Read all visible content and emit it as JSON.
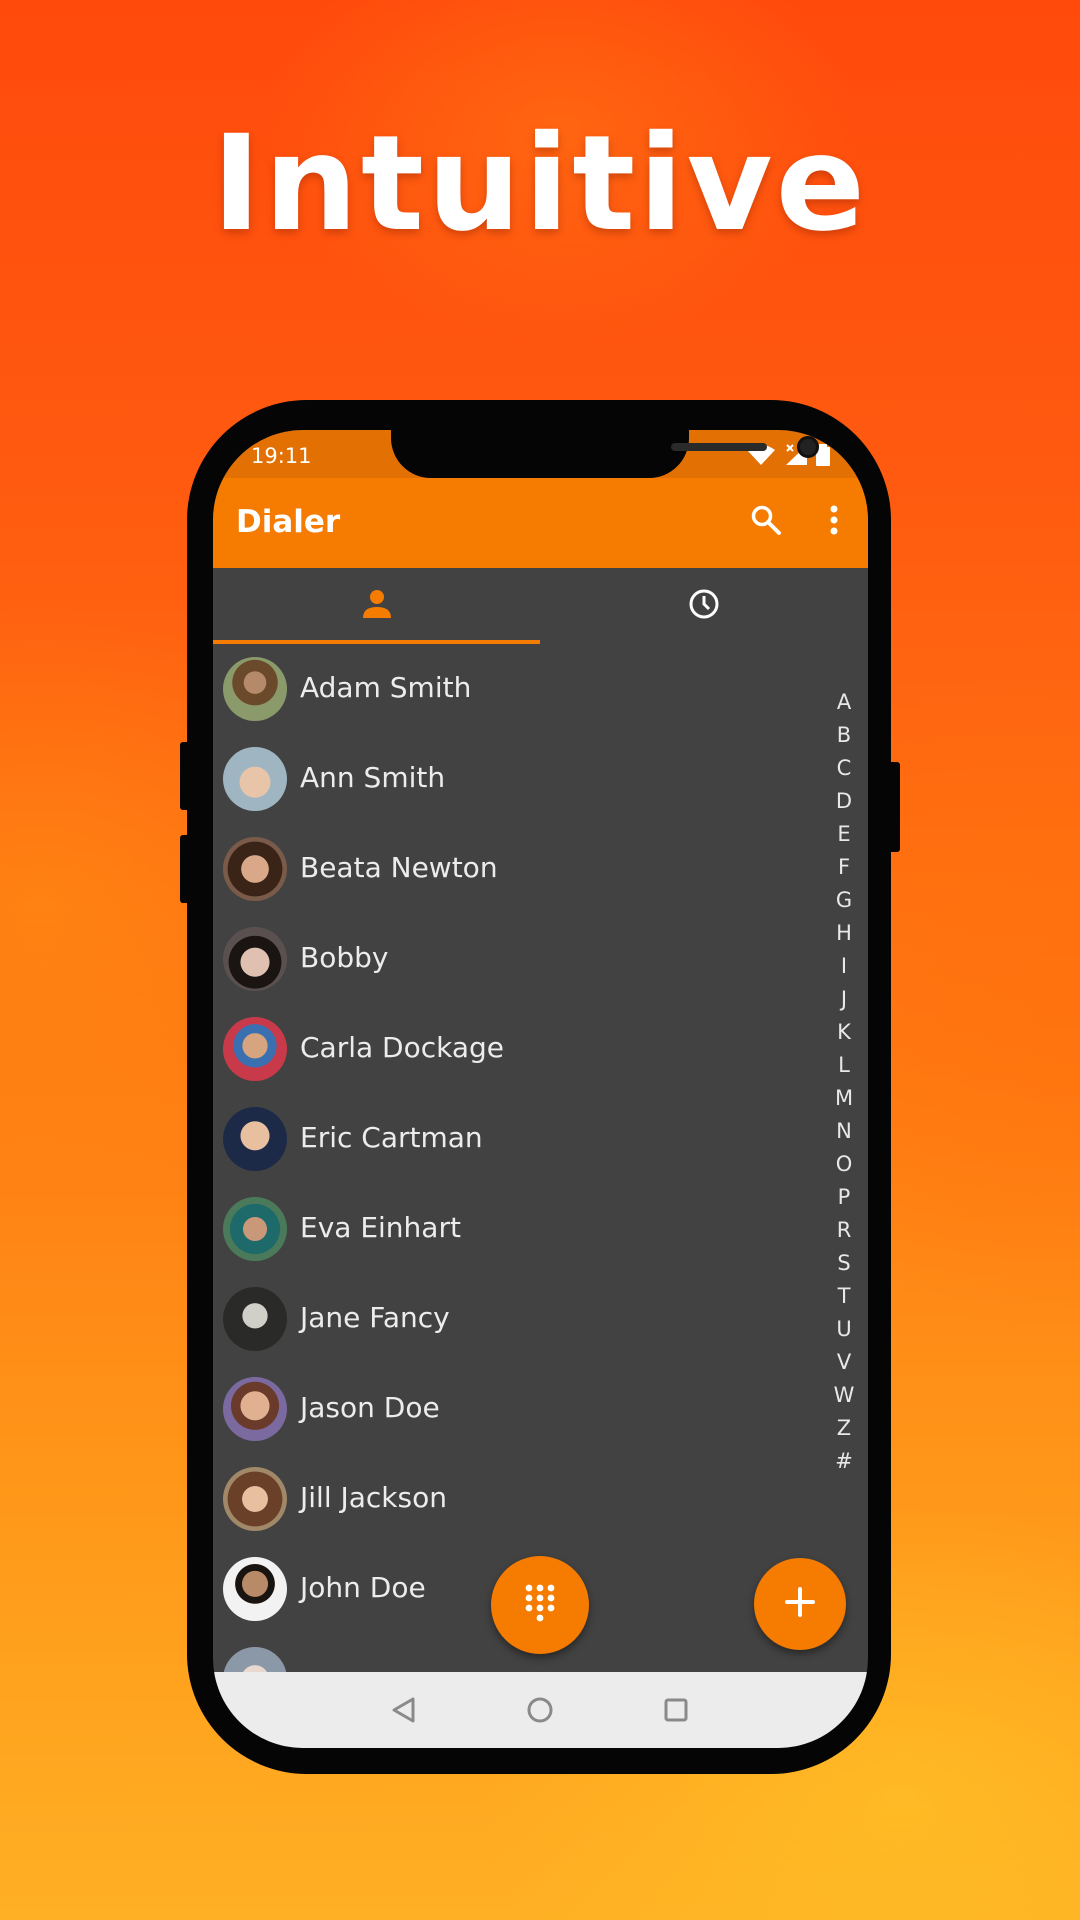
{
  "headline": "Intuitive",
  "status_bar": {
    "time": "19:11",
    "icons": [
      "wifi-icon",
      "signal-icon",
      "battery-icon"
    ]
  },
  "app_bar": {
    "title": "Dialer",
    "icons": [
      "search-icon",
      "more-vert-icon"
    ]
  },
  "tabs": [
    {
      "icon": "person-icon",
      "selected": true
    },
    {
      "icon": "clock-icon",
      "selected": false
    }
  ],
  "contacts": [
    {
      "name": "Adam Smith"
    },
    {
      "name": "Ann Smith"
    },
    {
      "name": "Beata Newton"
    },
    {
      "name": "Bobby"
    },
    {
      "name": "Carla Dockage"
    },
    {
      "name": "Eric Cartman"
    },
    {
      "name": "Eva Einhart"
    },
    {
      "name": "Jane Fancy"
    },
    {
      "name": "Jason Doe"
    },
    {
      "name": "Jill Jackson"
    },
    {
      "name": "John Doe"
    }
  ],
  "alphabet": [
    "A",
    "B",
    "C",
    "D",
    "E",
    "F",
    "G",
    "H",
    "I",
    "J",
    "K",
    "L",
    "M",
    "N",
    "O",
    "P",
    "R",
    "S",
    "T",
    "U",
    "V",
    "W",
    "Z",
    "#"
  ],
  "fabs": {
    "dialpad": "dialpad-icon",
    "add": "plus-icon"
  },
  "nav_bar": [
    "back-icon",
    "home-icon",
    "recents-icon"
  ],
  "colors": {
    "accent": "#f57c00",
    "status_bar": "#e27003",
    "background": "#424242",
    "nav_bar": "#ececec"
  }
}
